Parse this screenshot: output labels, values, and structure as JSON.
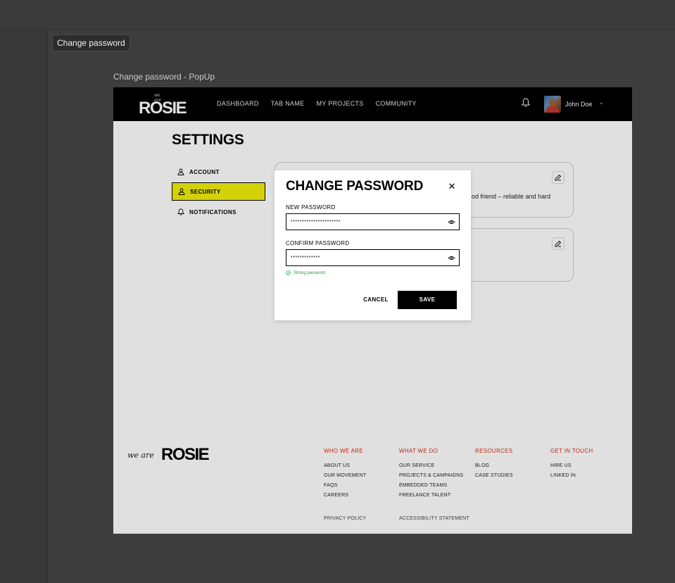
{
  "page_tag": "Change password",
  "frame_label": "Change password - PopUp",
  "navbar": {
    "logo_small": "we are",
    "logo": "ROSIE",
    "links": [
      "DASHBOARD",
      "TAB NAME",
      "MY PROJECTS",
      "COMMUNITY"
    ],
    "user_name": "John Doe"
  },
  "settings": {
    "title": "SETTINGS",
    "menu": [
      "ACCOUNT",
      "SECURITY",
      "NOTIFICATIONS"
    ],
    "active": "SECURITY"
  },
  "cards": {
    "card1_text": "od friend – reliable and hard"
  },
  "modal": {
    "title": "CHANGE PASSWORD",
    "new_label": "NEW PASSWORD",
    "new_value": "**********************",
    "confirm_label": "CONFIRM PASSWORD",
    "confirm_value": "*************",
    "hint": "Strong password",
    "cancel": "CANCEL",
    "save": "SAVE"
  },
  "footer": {
    "logo_small": "we are",
    "logo": "ROSIE",
    "columns": [
      {
        "heading": "WHO WE ARE",
        "links": [
          "ABOUT US",
          "OUR MOVEMENT",
          "FAQS",
          "CAREERS"
        ]
      },
      {
        "heading": "WHAT WE DO",
        "links": [
          "OUR SERVICE",
          "PROJECTS & CAMPAIGNS",
          "EMBEDDED TEAMS",
          "FREELANCE TALENT"
        ]
      },
      {
        "heading": "RESOURCES",
        "links": [
          "BLOG",
          "CASE STUDIES"
        ]
      },
      {
        "heading": "GET IN TOUCH",
        "links": [
          "HIRE US",
          "LINKED IN"
        ]
      }
    ],
    "privacy": "PRIVACY POLICY",
    "accessibility": "ACCESSIBILITY STATEMENT"
  },
  "colors": {
    "accent_yellow": "#f2ee0b",
    "footer_heading_red": "#d6331c",
    "success_green": "#1f9d3a"
  }
}
